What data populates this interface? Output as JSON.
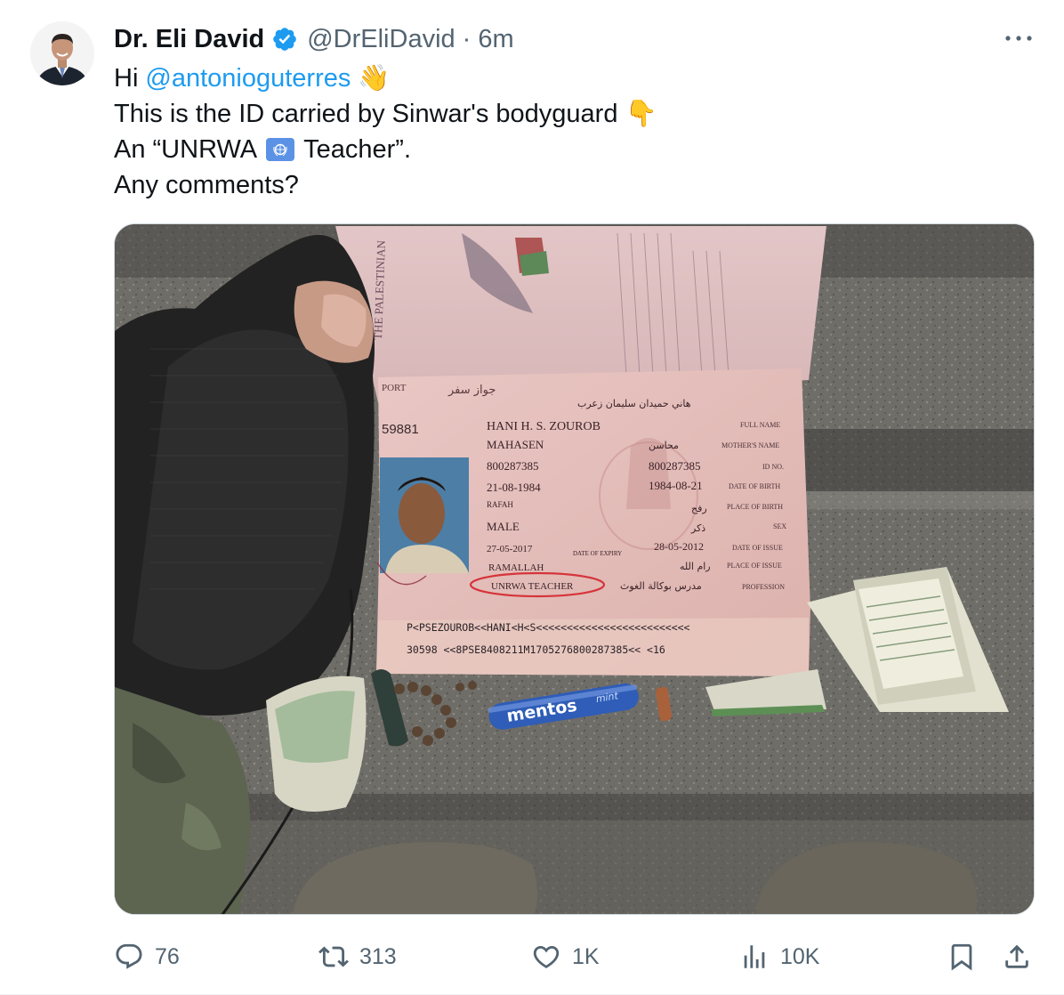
{
  "author": {
    "name": "Dr. Eli David",
    "handle": "@DrEliDavid",
    "separator": "·",
    "time": "6m"
  },
  "tweet": {
    "line1_prefix": "Hi",
    "mention": "@antonioguterres",
    "line1_emoji": "👋",
    "line2": "This is the ID carried by Sinwar's bodyguard",
    "line2_emoji": "👇",
    "line3_prefix": "An “UNRWA",
    "line3_flag": "🇺🇳",
    "line3_suffix": "Teacher”.",
    "line4": "Any comments?"
  },
  "photo": {
    "passport_top_label": "THE PALESTINIAN",
    "passport_label": "PORT",
    "passport_label_ar": "جواز سفر",
    "number_partial": "59881",
    "holder_name": "HANI H. S. ZOUROB",
    "holder_name_ar": "هاني حميدان سليمان زعرب",
    "mother_name": "MAHASEN",
    "mother_name_ar": "محاسن",
    "id_no": "800287385",
    "id_no_right": "800287385",
    "dob": "21-08-1984",
    "dob_right": "1984-08-21",
    "place_of_birth": "RAFAH",
    "place_of_birth_ar": "رفح",
    "sex": "MALE",
    "sex_ar": "ذكر",
    "date_of_expiry": "27-05-2017",
    "date_of_issue": "28-05-2012",
    "place_of_issue": "RAMALLAH",
    "place_of_issue_ar": "رام الله",
    "profession": "UNRWA TEACHER",
    "profession_ar": "مدرس بوكالة الغوث",
    "label_full_name": "FULL NAME",
    "label_mothers_name": "MOTHER'S NAME",
    "label_id_no": "ID NO.",
    "label_dob": "DATE OF BIRTH",
    "label_pob": "PLACE OF BIRTH",
    "label_sex": "SEX",
    "label_doi": "DATE OF ISSUE",
    "label_poi": "PLACE OF ISSUE",
    "label_profession": "PROFESSION",
    "label_expiry": "DATE OF EXPIRY",
    "mrz_line1": "P<PSEZOUROB<<HANI<H<S<<<<<<<<<<<<<<<<<<<<<<<<<",
    "mrz_line2": "30598  <<8PSE8408211M1705276800287385<<  <16",
    "mentos": "mentos",
    "mentos_small": "mint"
  },
  "actions": {
    "replies": "76",
    "reposts": "313",
    "likes": "1K",
    "views": "10K"
  },
  "colors": {
    "accent": "#1d9bf0",
    "muted": "#536471",
    "text": "#0f1419"
  }
}
